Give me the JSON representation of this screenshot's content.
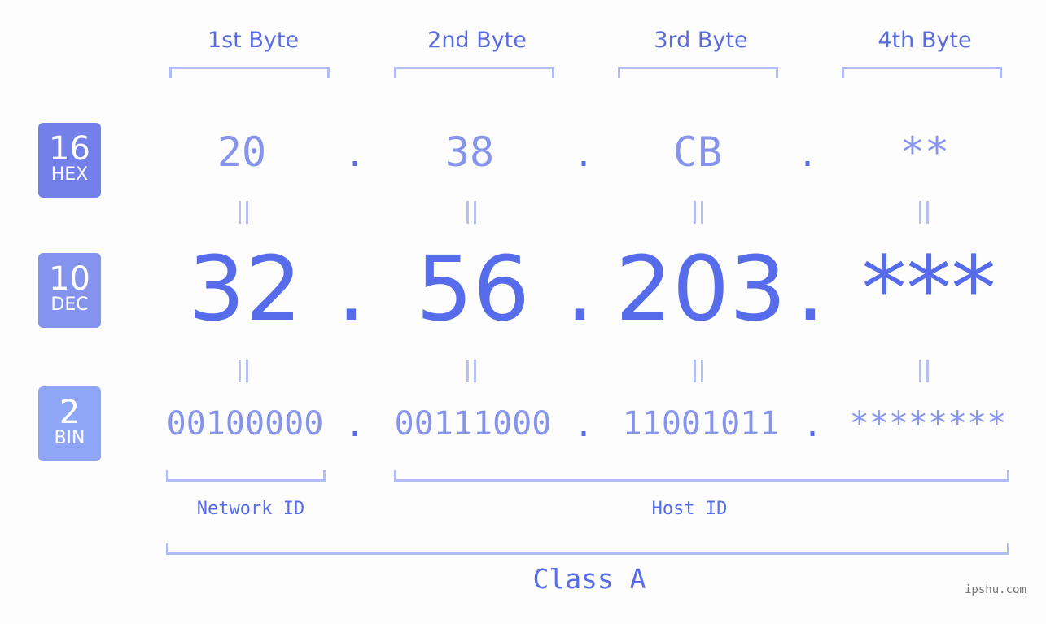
{
  "bytes": {
    "headers": [
      "1st Byte",
      "2nd Byte",
      "3rd Byte",
      "4th Byte"
    ]
  },
  "badges": {
    "hex": {
      "num": "16",
      "label": "HEX",
      "color": "#7380ea"
    },
    "dec": {
      "num": "10",
      "label": "DEC",
      "color": "#8494ee"
    },
    "bin": {
      "num": "2",
      "label": "BIN",
      "color": "#8fa6f6"
    }
  },
  "hex_values": [
    "20",
    "38",
    "CB",
    "**"
  ],
  "dec_values": [
    "32",
    "56",
    "203",
    "***"
  ],
  "bin_values": [
    "00100000",
    "00111000",
    "11001011",
    "********"
  ],
  "separator": ".",
  "labels": {
    "network_id": "Network ID",
    "host_id": "Host ID",
    "class": "Class A"
  },
  "watermark": "ipshu.com",
  "colors": {
    "accent": "#566cea",
    "light": "#8794ec",
    "bracket": "#b2bcf6"
  }
}
